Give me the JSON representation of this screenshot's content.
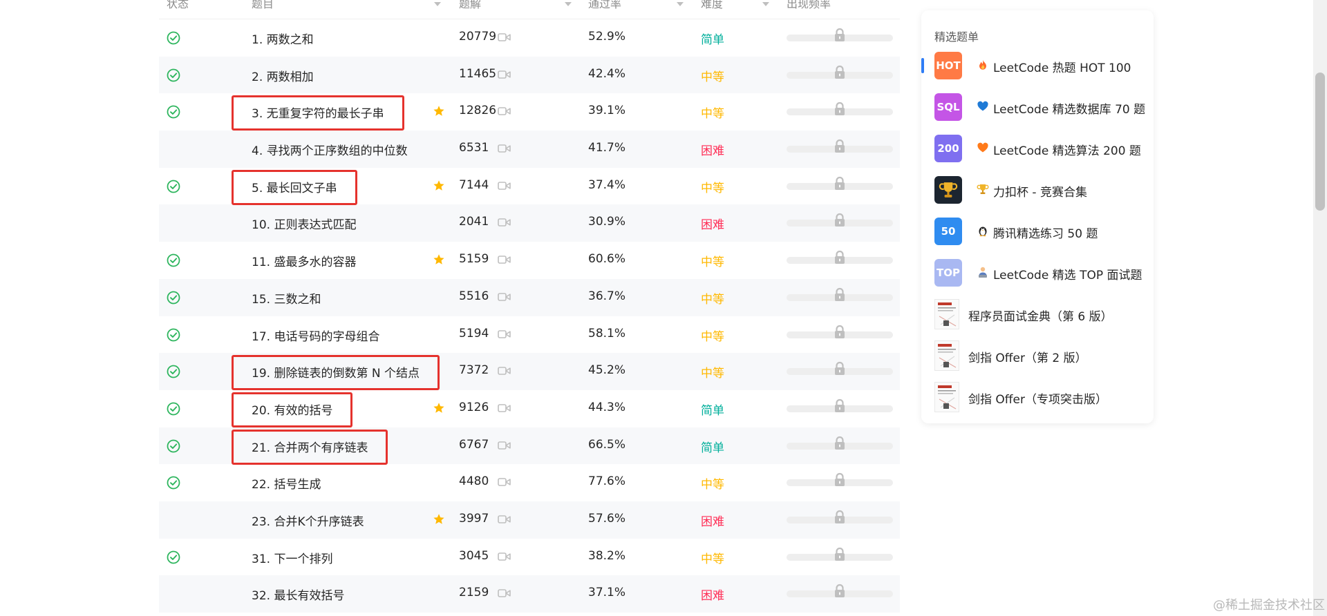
{
  "table": {
    "headers": {
      "status": "状态",
      "title": "题目",
      "solutions": "题解",
      "acceptance": "通过率",
      "difficulty": "难度",
      "frequency": "出现频率"
    },
    "rows": [
      {
        "title": "1. 两数之和",
        "solutions": "20779",
        "acceptance": "52.9%",
        "difficulty": "简单",
        "level": "easy",
        "solved": true,
        "starred": false
      },
      {
        "title": "2. 两数相加",
        "solutions": "11465",
        "acceptance": "42.4%",
        "difficulty": "中等",
        "level": "medium",
        "solved": true,
        "starred": false
      },
      {
        "title": "3. 无重复字符的最长子串",
        "solutions": "12826",
        "acceptance": "39.1%",
        "difficulty": "中等",
        "level": "medium",
        "solved": true,
        "starred": true
      },
      {
        "title": "4. 寻找两个正序数组的中位数",
        "solutions": "6531",
        "acceptance": "41.7%",
        "difficulty": "困难",
        "level": "hard",
        "solved": false,
        "starred": false
      },
      {
        "title": "5. 最长回文子串",
        "solutions": "7144",
        "acceptance": "37.4%",
        "difficulty": "中等",
        "level": "medium",
        "solved": true,
        "starred": true
      },
      {
        "title": "10. 正则表达式匹配",
        "solutions": "2041",
        "acceptance": "30.9%",
        "difficulty": "困难",
        "level": "hard",
        "solved": false,
        "starred": false
      },
      {
        "title": "11. 盛最多水的容器",
        "solutions": "5159",
        "acceptance": "60.6%",
        "difficulty": "中等",
        "level": "medium",
        "solved": true,
        "starred": true
      },
      {
        "title": "15. 三数之和",
        "solutions": "5516",
        "acceptance": "36.7%",
        "difficulty": "中等",
        "level": "medium",
        "solved": true,
        "starred": false
      },
      {
        "title": "17. 电话号码的字母组合",
        "solutions": "5194",
        "acceptance": "58.1%",
        "difficulty": "中等",
        "level": "medium",
        "solved": true,
        "starred": false
      },
      {
        "title": "19. 删除链表的倒数第 N 个结点",
        "solutions": "7372",
        "acceptance": "45.2%",
        "difficulty": "中等",
        "level": "medium",
        "solved": true,
        "starred": false
      },
      {
        "title": "20. 有效的括号",
        "solutions": "9126",
        "acceptance": "44.3%",
        "difficulty": "简单",
        "level": "easy",
        "solved": true,
        "starred": true
      },
      {
        "title": "21. 合并两个有序链表",
        "solutions": "6767",
        "acceptance": "66.5%",
        "difficulty": "简单",
        "level": "easy",
        "solved": true,
        "starred": false
      },
      {
        "title": "22. 括号生成",
        "solutions": "4480",
        "acceptance": "77.6%",
        "difficulty": "中等",
        "level": "medium",
        "solved": true,
        "starred": false
      },
      {
        "title": "23. 合并K个升序链表",
        "solutions": "3997",
        "acceptance": "57.6%",
        "difficulty": "困难",
        "level": "hard",
        "solved": false,
        "starred": true
      },
      {
        "title": "31. 下一个排列",
        "solutions": "3045",
        "acceptance": "38.2%",
        "difficulty": "中等",
        "level": "medium",
        "solved": true,
        "starred": false
      },
      {
        "title": "32. 最长有效括号",
        "solutions": "2159",
        "acceptance": "37.1%",
        "difficulty": "困难",
        "level": "hard",
        "solved": false,
        "starred": false
      }
    ]
  },
  "highlighted_rows": [
    2,
    4,
    9,
    10,
    11
  ],
  "colors": {
    "easy": "#00af9b",
    "medium": "#ffb800",
    "hard": "#ff2d55",
    "solved_check": "#2db55d",
    "star": "#ffb800",
    "annotation": "#e5322d",
    "accent": "#2f7df6"
  },
  "panel": {
    "title": "精选题单",
    "items": [
      {
        "label": "LeetCode 热题 HOT 100",
        "thumb": "HOT",
        "thumb_color": "#ff7a45",
        "badge_icon": "fire-icon",
        "active": true
      },
      {
        "label": "LeetCode 精选数据库 70 题",
        "thumb": "SQL",
        "thumb_color": "#c455e6",
        "badge_icon": "blue-heart-icon",
        "active": false
      },
      {
        "label": "LeetCode 精选算法 200 题",
        "thumb": "200",
        "thumb_color": "#7f6ff0",
        "badge_icon": "orange-heart-icon",
        "active": false
      },
      {
        "label": "力扣杯 - 竞赛合集",
        "thumb": "",
        "thumb_color": "#1c2530",
        "badge_icon": "trophy-icon",
        "active": false
      },
      {
        "label": "腾讯精选练习 50 题",
        "thumb": "50",
        "thumb_color": "#2f8cf0",
        "badge_icon": "penguin-icon",
        "active": false
      },
      {
        "label": "LeetCode 精选 TOP 面试题",
        "thumb": "TOP",
        "thumb_color": "#a9b8f2",
        "badge_icon": "person-icon",
        "active": false
      },
      {
        "label": "程序员面试金典（第 6 版）",
        "thumb": "",
        "thumb_color": "",
        "badge_icon": "",
        "active": false
      },
      {
        "label": "剑指 Offer（第 2 版）",
        "thumb": "",
        "thumb_color": "",
        "badge_icon": "",
        "active": false
      },
      {
        "label": "剑指 Offer（专项突击版）",
        "thumb": "",
        "thumb_color": "",
        "badge_icon": "",
        "active": false
      }
    ]
  },
  "watermark": "@稀土掘金技术社区"
}
